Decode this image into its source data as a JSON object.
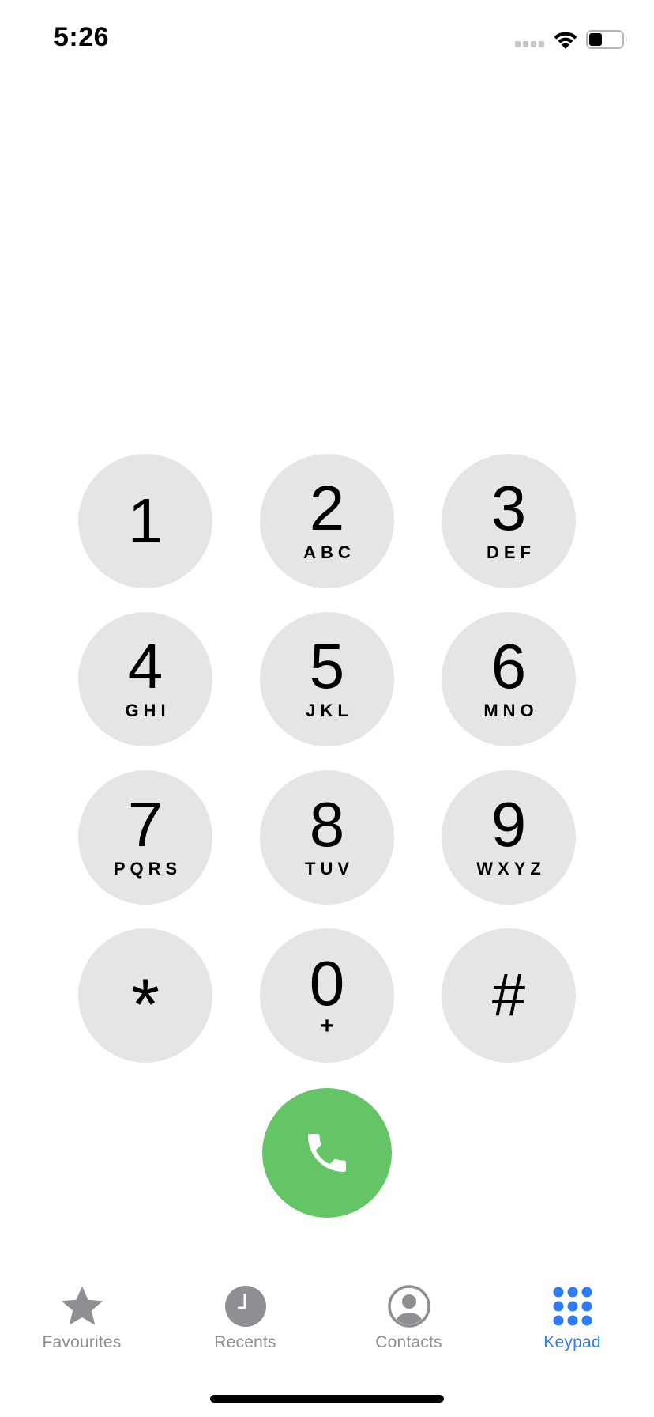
{
  "status_bar": {
    "time": "5:26"
  },
  "keypad": {
    "keys": [
      {
        "digit": "1",
        "letters": ""
      },
      {
        "digit": "2",
        "letters": "ABC"
      },
      {
        "digit": "3",
        "letters": "DEF"
      },
      {
        "digit": "4",
        "letters": "GHI"
      },
      {
        "digit": "5",
        "letters": "JKL"
      },
      {
        "digit": "6",
        "letters": "MNO"
      },
      {
        "digit": "7",
        "letters": "PQRS"
      },
      {
        "digit": "8",
        "letters": "TUV"
      },
      {
        "digit": "9",
        "letters": "WXYZ"
      },
      {
        "digit": "*",
        "letters": ""
      },
      {
        "digit": "0",
        "letters": "+"
      },
      {
        "digit": "#",
        "letters": ""
      }
    ],
    "call_button_icon": "phone-icon",
    "call_button_color": "#65c466"
  },
  "tab_bar": {
    "tabs": [
      {
        "label": "Favourites",
        "icon": "star-icon",
        "active": false
      },
      {
        "label": "Recents",
        "icon": "clock-icon",
        "active": false
      },
      {
        "label": "Contacts",
        "icon": "person-circle-icon",
        "active": false
      },
      {
        "label": "Keypad",
        "icon": "keypad-grid-icon",
        "active": true
      }
    ],
    "active_color": "#2f7cf6",
    "inactive_color": "#8e8e93"
  }
}
